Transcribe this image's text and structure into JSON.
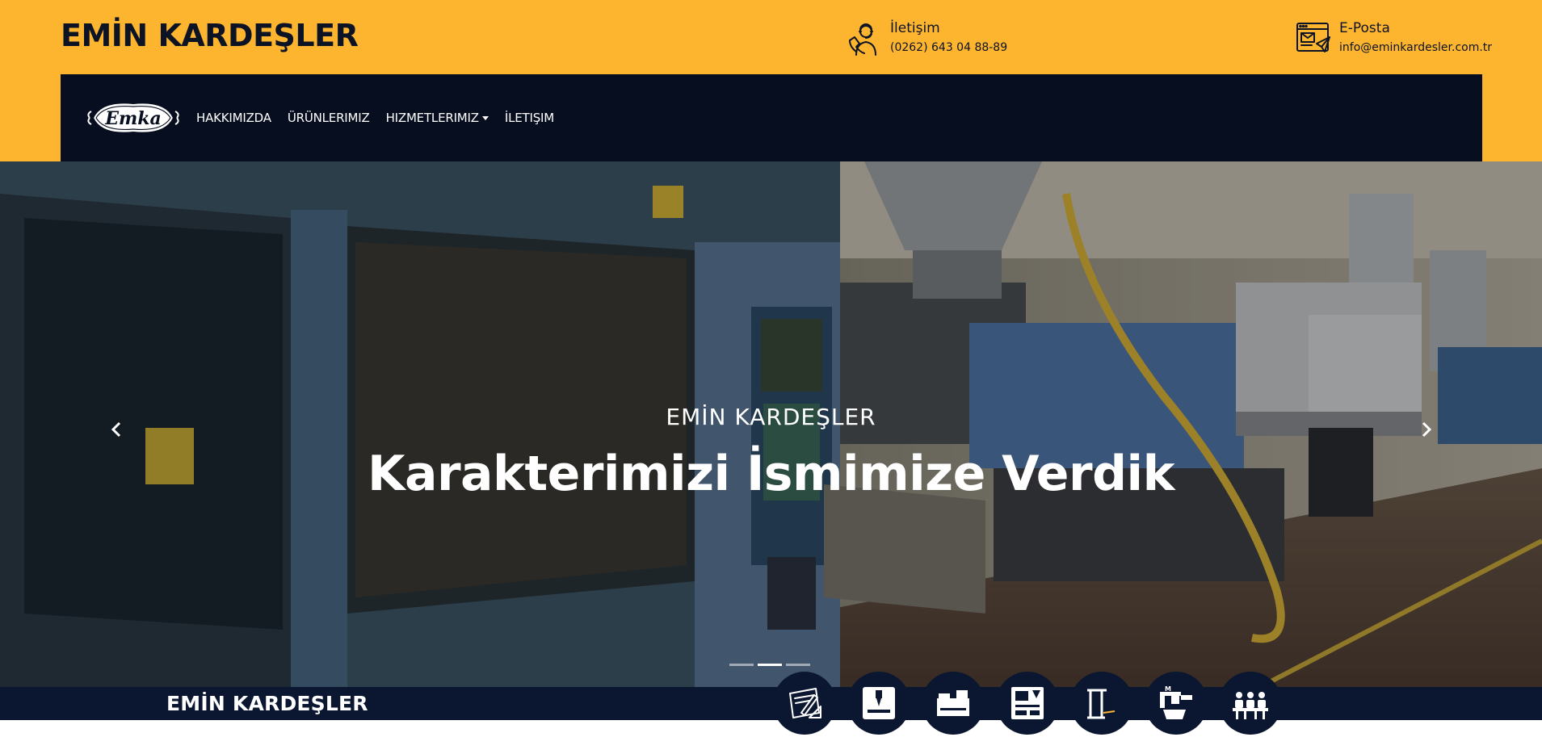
{
  "header": {
    "brand": "EMİN KARDEŞLER",
    "phone": {
      "title": "İletişim",
      "value": "(0262) 643 04 88-89",
      "icon": "support-agent-icon"
    },
    "email": {
      "title": "E-Posta",
      "value": "info@eminkardesler.com.tr",
      "icon": "email-browser-icon"
    }
  },
  "nav": {
    "logo_text": "Emka",
    "items": [
      {
        "label": "HAKKIMIZDA"
      },
      {
        "label": "ÜRÜNLERIMIZ"
      },
      {
        "label": "HIZMETLERIMIZ"
      },
      {
        "label": "İLETIŞIM"
      }
    ]
  },
  "hero": {
    "subtitle": "EMİN KARDEŞLER",
    "title": "Karakterimizi İsmimize Verdik",
    "slides": 3,
    "active_slide": 2
  },
  "footer_strip": {
    "brand": "EMİN KARDEŞLER",
    "service_icons": [
      "design-drafting-icon",
      "cnc-drill-icon",
      "cnc-machine-icon",
      "control-panel-icon",
      "press-frame-icon",
      "measurement-machine-icon",
      "team-icon"
    ]
  },
  "colors": {
    "topbar": "#FDB52F",
    "navbar": "#070e1f",
    "strip": "#0b1730",
    "text_dark": "#0c1324"
  }
}
